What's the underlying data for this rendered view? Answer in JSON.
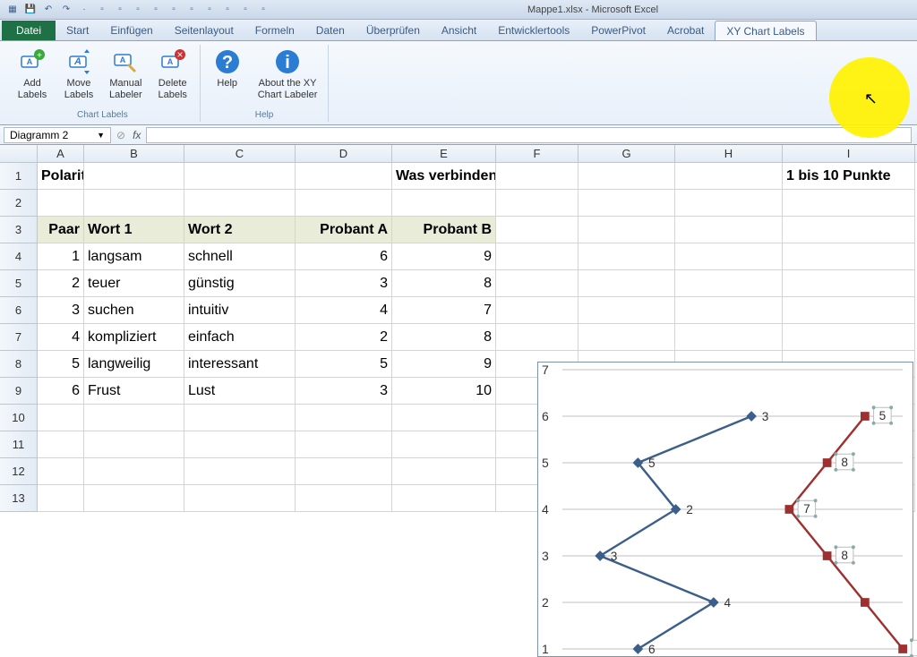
{
  "title_doc": "Mappe1.xlsx",
  "title_app": "Microsoft Excel",
  "tabs": {
    "file": "Datei",
    "list": [
      "Start",
      "Einfügen",
      "Seitenlayout",
      "Formeln",
      "Daten",
      "Überprüfen",
      "Ansicht",
      "Entwicklertools",
      "PowerPivot",
      "Acrobat",
      "XY Chart Labels"
    ],
    "active": "XY Chart Labels"
  },
  "ribbon": {
    "group1": {
      "label": "Chart Labels",
      "btns": [
        {
          "name": "add-labels",
          "l1": "Add",
          "l2": "Labels"
        },
        {
          "name": "move-labels",
          "l1": "Move",
          "l2": "Labels"
        },
        {
          "name": "manual-labeler",
          "l1": "Manual",
          "l2": "Labeler"
        },
        {
          "name": "delete-labels",
          "l1": "Delete",
          "l2": "Labels"
        }
      ]
    },
    "group2": {
      "label": "Help",
      "btns": [
        {
          "name": "help",
          "l1": "Help",
          "l2": ""
        },
        {
          "name": "about",
          "l1": "About the XY",
          "l2": "Chart Labeler"
        }
      ]
    }
  },
  "namebox": "Diagramm 2",
  "fx": "fx",
  "colheads": [
    "A",
    "B",
    "C",
    "D",
    "E",
    "F",
    "G",
    "H",
    "I"
  ],
  "cells": {
    "r1": {
      "A": "Polaritätsprofil / Semantisches Differential",
      "E": "Was verbinden Sie mit dem Begriff \"Excel\"",
      "I": "1 bis 10 Punkte"
    },
    "r3": {
      "A": "Paar",
      "B": "Wort 1",
      "C": "Wort 2",
      "D": "Probant A",
      "E": "Probant B"
    },
    "rows": [
      {
        "n": "1",
        "w1": "langsam",
        "w2": "schnell",
        "a": "6",
        "b": "9"
      },
      {
        "n": "2",
        "w1": "teuer",
        "w2": "günstig",
        "a": "3",
        "b": "8"
      },
      {
        "n": "3",
        "w1": "suchen",
        "w2": "intuitiv",
        "a": "4",
        "b": "7"
      },
      {
        "n": "4",
        "w1": "kompliziert",
        "w2": "einfach",
        "a": "2",
        "b": "8"
      },
      {
        "n": "5",
        "w1": "langweilig",
        "w2": "interessant",
        "a": "5",
        "b": "9"
      },
      {
        "n": "6",
        "w1": "Frust",
        "w2": "Lust",
        "a": "3",
        "b": "10"
      }
    ]
  },
  "chart_data": {
    "type": "line",
    "title": "",
    "xlabel": "",
    "ylabel": "",
    "ylim": [
      1,
      7
    ],
    "y_ticks": [
      1,
      2,
      3,
      4,
      5,
      6,
      7
    ],
    "series": [
      {
        "name": "Probant A",
        "color": "#3b5f8a",
        "y": [
          6,
          5,
          4,
          3,
          2,
          1
        ],
        "x": [
          6,
          3,
          4,
          2,
          5,
          3
        ],
        "labels": [
          "3",
          "5",
          "2",
          "3",
          "4",
          "6"
        ]
      },
      {
        "name": "Probant B",
        "color": "#a03030",
        "y": [
          6,
          5,
          4,
          3,
          2,
          1
        ],
        "x": [
          9,
          8,
          7,
          8,
          9,
          10
        ],
        "labels": [
          "5",
          "8",
          "7",
          "8",
          "",
          " "
        ]
      }
    ],
    "xlim": [
      1,
      10
    ]
  }
}
